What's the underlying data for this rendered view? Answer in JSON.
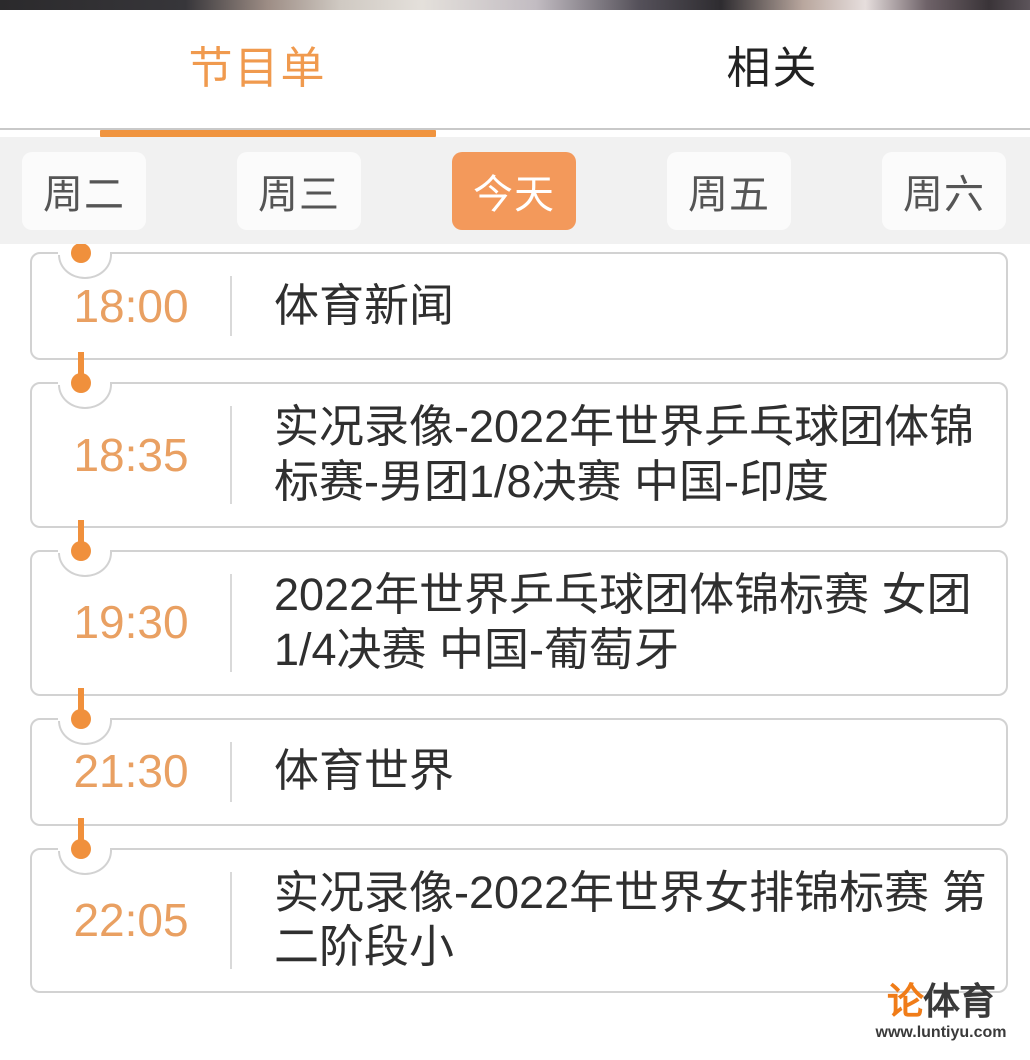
{
  "header": {
    "photo_strip_alt": "partial-photo-banner"
  },
  "tabs": [
    {
      "label": "节目单",
      "active": true
    },
    {
      "label": "相关",
      "active": false
    }
  ],
  "day_selector": {
    "days": [
      {
        "label": "周二",
        "selected": false
      },
      {
        "label": "周三",
        "selected": false
      },
      {
        "label": "今天",
        "selected": true
      },
      {
        "label": "周五",
        "selected": false
      },
      {
        "label": "周六",
        "selected": false
      }
    ]
  },
  "schedule": {
    "programs": [
      {
        "time": "18:00",
        "title": "体育新闻"
      },
      {
        "time": "18:35",
        "title": "实况录像-2022年世界乒乓球团体锦标赛-男团1/8决赛 中国-印度"
      },
      {
        "time": "19:30",
        "title": "2022年世界乒乓球团体锦标赛 女团1/4决赛 中国-葡萄牙"
      },
      {
        "time": "21:30",
        "title": "体育世界"
      },
      {
        "time": "22:05",
        "title": "实况录像-2022年世界女排锦标赛 第二阶段小"
      }
    ]
  },
  "watermark": {
    "logo_char": "论",
    "word": "体育",
    "url": "www.luntiyu.com"
  },
  "colors": {
    "accent": "#f0943f",
    "accent_chip": "#f3995b",
    "time_text": "#e9a062",
    "title_text": "#2f2f2f",
    "strip_bg": "#f1f1f1",
    "card_border": "#d2d2d2",
    "watermark_orange": "#f07c18"
  }
}
